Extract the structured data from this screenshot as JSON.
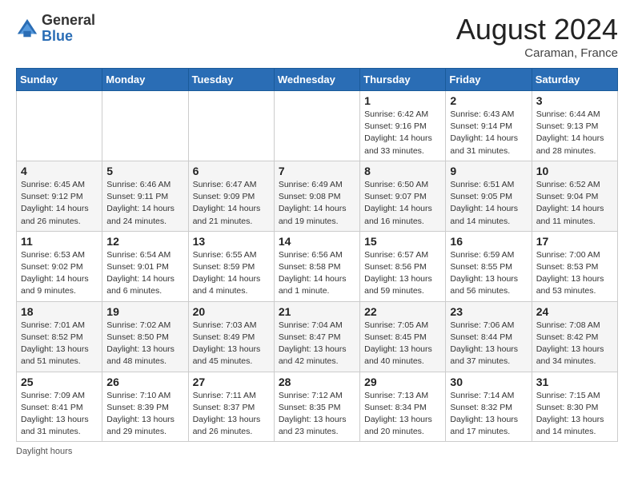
{
  "logo": {
    "general": "General",
    "blue": "Blue"
  },
  "header": {
    "month_year": "August 2024",
    "location": "Caraman, France"
  },
  "days_of_week": [
    "Sunday",
    "Monday",
    "Tuesday",
    "Wednesday",
    "Thursday",
    "Friday",
    "Saturday"
  ],
  "weeks": [
    [
      {
        "day": "",
        "sunrise": "",
        "sunset": "",
        "daylight": ""
      },
      {
        "day": "",
        "sunrise": "",
        "sunset": "",
        "daylight": ""
      },
      {
        "day": "",
        "sunrise": "",
        "sunset": "",
        "daylight": ""
      },
      {
        "day": "",
        "sunrise": "",
        "sunset": "",
        "daylight": ""
      },
      {
        "day": "1",
        "sunrise": "Sunrise: 6:42 AM",
        "sunset": "Sunset: 9:16 PM",
        "daylight": "Daylight: 14 hours and 33 minutes."
      },
      {
        "day": "2",
        "sunrise": "Sunrise: 6:43 AM",
        "sunset": "Sunset: 9:14 PM",
        "daylight": "Daylight: 14 hours and 31 minutes."
      },
      {
        "day": "3",
        "sunrise": "Sunrise: 6:44 AM",
        "sunset": "Sunset: 9:13 PM",
        "daylight": "Daylight: 14 hours and 28 minutes."
      }
    ],
    [
      {
        "day": "4",
        "sunrise": "Sunrise: 6:45 AM",
        "sunset": "Sunset: 9:12 PM",
        "daylight": "Daylight: 14 hours and 26 minutes."
      },
      {
        "day": "5",
        "sunrise": "Sunrise: 6:46 AM",
        "sunset": "Sunset: 9:11 PM",
        "daylight": "Daylight: 14 hours and 24 minutes."
      },
      {
        "day": "6",
        "sunrise": "Sunrise: 6:47 AM",
        "sunset": "Sunset: 9:09 PM",
        "daylight": "Daylight: 14 hours and 21 minutes."
      },
      {
        "day": "7",
        "sunrise": "Sunrise: 6:49 AM",
        "sunset": "Sunset: 9:08 PM",
        "daylight": "Daylight: 14 hours and 19 minutes."
      },
      {
        "day": "8",
        "sunrise": "Sunrise: 6:50 AM",
        "sunset": "Sunset: 9:07 PM",
        "daylight": "Daylight: 14 hours and 16 minutes."
      },
      {
        "day": "9",
        "sunrise": "Sunrise: 6:51 AM",
        "sunset": "Sunset: 9:05 PM",
        "daylight": "Daylight: 14 hours and 14 minutes."
      },
      {
        "day": "10",
        "sunrise": "Sunrise: 6:52 AM",
        "sunset": "Sunset: 9:04 PM",
        "daylight": "Daylight: 14 hours and 11 minutes."
      }
    ],
    [
      {
        "day": "11",
        "sunrise": "Sunrise: 6:53 AM",
        "sunset": "Sunset: 9:02 PM",
        "daylight": "Daylight: 14 hours and 9 minutes."
      },
      {
        "day": "12",
        "sunrise": "Sunrise: 6:54 AM",
        "sunset": "Sunset: 9:01 PM",
        "daylight": "Daylight: 14 hours and 6 minutes."
      },
      {
        "day": "13",
        "sunrise": "Sunrise: 6:55 AM",
        "sunset": "Sunset: 8:59 PM",
        "daylight": "Daylight: 14 hours and 4 minutes."
      },
      {
        "day": "14",
        "sunrise": "Sunrise: 6:56 AM",
        "sunset": "Sunset: 8:58 PM",
        "daylight": "Daylight: 14 hours and 1 minute."
      },
      {
        "day": "15",
        "sunrise": "Sunrise: 6:57 AM",
        "sunset": "Sunset: 8:56 PM",
        "daylight": "Daylight: 13 hours and 59 minutes."
      },
      {
        "day": "16",
        "sunrise": "Sunrise: 6:59 AM",
        "sunset": "Sunset: 8:55 PM",
        "daylight": "Daylight: 13 hours and 56 minutes."
      },
      {
        "day": "17",
        "sunrise": "Sunrise: 7:00 AM",
        "sunset": "Sunset: 8:53 PM",
        "daylight": "Daylight: 13 hours and 53 minutes."
      }
    ],
    [
      {
        "day": "18",
        "sunrise": "Sunrise: 7:01 AM",
        "sunset": "Sunset: 8:52 PM",
        "daylight": "Daylight: 13 hours and 51 minutes."
      },
      {
        "day": "19",
        "sunrise": "Sunrise: 7:02 AM",
        "sunset": "Sunset: 8:50 PM",
        "daylight": "Daylight: 13 hours and 48 minutes."
      },
      {
        "day": "20",
        "sunrise": "Sunrise: 7:03 AM",
        "sunset": "Sunset: 8:49 PM",
        "daylight": "Daylight: 13 hours and 45 minutes."
      },
      {
        "day": "21",
        "sunrise": "Sunrise: 7:04 AM",
        "sunset": "Sunset: 8:47 PM",
        "daylight": "Daylight: 13 hours and 42 minutes."
      },
      {
        "day": "22",
        "sunrise": "Sunrise: 7:05 AM",
        "sunset": "Sunset: 8:45 PM",
        "daylight": "Daylight: 13 hours and 40 minutes."
      },
      {
        "day": "23",
        "sunrise": "Sunrise: 7:06 AM",
        "sunset": "Sunset: 8:44 PM",
        "daylight": "Daylight: 13 hours and 37 minutes."
      },
      {
        "day": "24",
        "sunrise": "Sunrise: 7:08 AM",
        "sunset": "Sunset: 8:42 PM",
        "daylight": "Daylight: 13 hours and 34 minutes."
      }
    ],
    [
      {
        "day": "25",
        "sunrise": "Sunrise: 7:09 AM",
        "sunset": "Sunset: 8:41 PM",
        "daylight": "Daylight: 13 hours and 31 minutes."
      },
      {
        "day": "26",
        "sunrise": "Sunrise: 7:10 AM",
        "sunset": "Sunset: 8:39 PM",
        "daylight": "Daylight: 13 hours and 29 minutes."
      },
      {
        "day": "27",
        "sunrise": "Sunrise: 7:11 AM",
        "sunset": "Sunset: 8:37 PM",
        "daylight": "Daylight: 13 hours and 26 minutes."
      },
      {
        "day": "28",
        "sunrise": "Sunrise: 7:12 AM",
        "sunset": "Sunset: 8:35 PM",
        "daylight": "Daylight: 13 hours and 23 minutes."
      },
      {
        "day": "29",
        "sunrise": "Sunrise: 7:13 AM",
        "sunset": "Sunset: 8:34 PM",
        "daylight": "Daylight: 13 hours and 20 minutes."
      },
      {
        "day": "30",
        "sunrise": "Sunrise: 7:14 AM",
        "sunset": "Sunset: 8:32 PM",
        "daylight": "Daylight: 13 hours and 17 minutes."
      },
      {
        "day": "31",
        "sunrise": "Sunrise: 7:15 AM",
        "sunset": "Sunset: 8:30 PM",
        "daylight": "Daylight: 13 hours and 14 minutes."
      }
    ]
  ],
  "footer": {
    "note": "Daylight hours"
  }
}
